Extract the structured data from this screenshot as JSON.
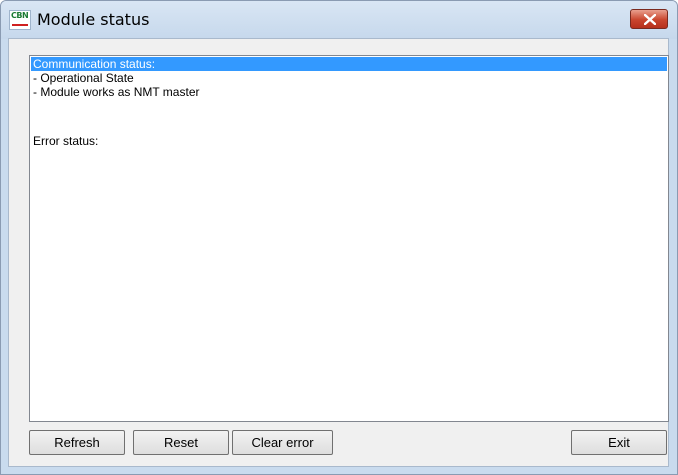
{
  "window": {
    "title": "Module status",
    "app_icon_text": "CBN",
    "app_icon": "cbn-logo-icon",
    "close_icon": "close-icon"
  },
  "status_list": {
    "rows": [
      {
        "text": "Communication status:",
        "selected": true
      },
      {
        "text": "- Operational State",
        "selected": false
      },
      {
        "text": "- Module works as NMT master",
        "selected": false
      },
      {
        "text": "",
        "selected": false
      },
      {
        "text": "",
        "selected": false
      },
      {
        "text": "Error status:",
        "selected": false
      }
    ]
  },
  "buttons": {
    "refresh": "Refresh",
    "reset": "Reset",
    "clear_error": "Clear error",
    "exit": "Exit"
  },
  "colors": {
    "selection": "#3399ff",
    "close_button": "#c9452d"
  }
}
